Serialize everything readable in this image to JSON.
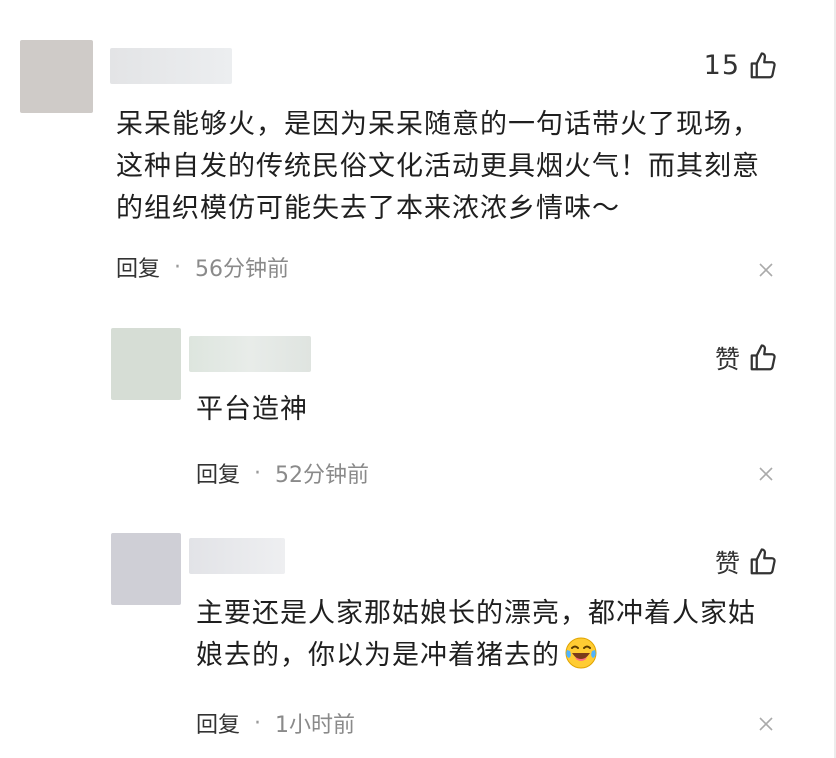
{
  "comments": [
    {
      "like_text": "15",
      "content_lines": [
        "呆呆能够火，是因为呆呆随意的一句话带火了现场，",
        "这种自发的传统民俗文化活动更具烟火气！而其刻意",
        "的组织模仿可能失去了本来浓浓乡情味～"
      ],
      "reply_label": "回复",
      "separator": "·",
      "time": "56分钟前"
    },
    {
      "like_text": "赞",
      "content_lines": [
        "平台造神"
      ],
      "reply_label": "回复",
      "separator": "·",
      "time": "52分钟前"
    },
    {
      "like_text": "赞",
      "content_lines": [
        "主要还是人家那姑娘长的漂亮，都冲着人家姑",
        "娘去的，你以为是冲着猪去的"
      ],
      "emoji": "laughing-tears-emoji",
      "reply_label": "回复",
      "separator": "·",
      "time": "1小时前"
    }
  ],
  "colors": {
    "avatar_1": "#cfcbc8",
    "avatar_2": "#d6ddd5",
    "avatar_3": "#cfcfd6",
    "name_bar": "#e4e5e7",
    "text": "#1f1f1f",
    "muted": "#8a8a8a"
  }
}
